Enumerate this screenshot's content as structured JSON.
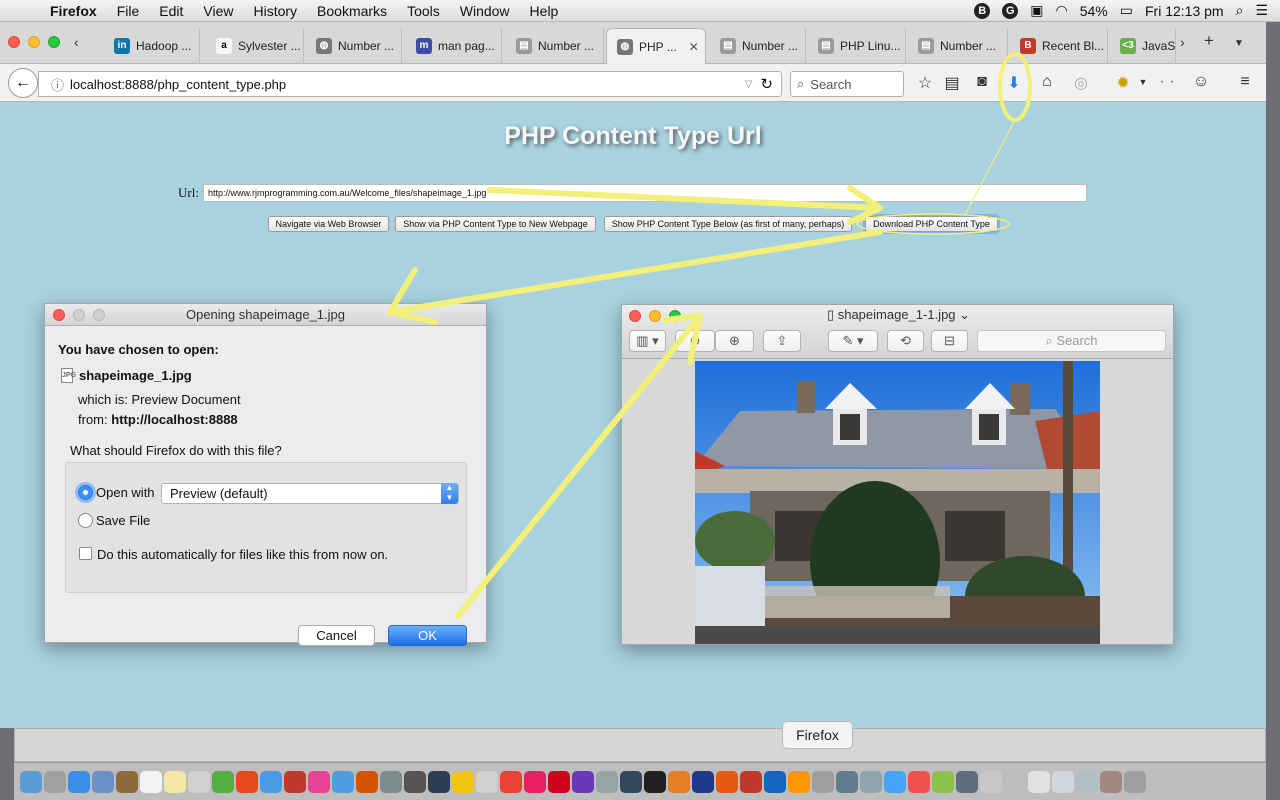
{
  "menubar": {
    "app": "Firefox",
    "items": [
      "File",
      "Edit",
      "View",
      "History",
      "Bookmarks",
      "Tools",
      "Window",
      "Help"
    ],
    "battery": "54%",
    "clock": "Fri 12:13 pm"
  },
  "tabs": [
    {
      "label": "Hadoop ...",
      "favicon": "linkedin-icon",
      "color": "#0e76a8",
      "glyph": "in"
    },
    {
      "label": "Sylvester ...",
      "favicon": "amazon-icon",
      "color": "#f6f6f6",
      "glyph": "a"
    },
    {
      "label": "Number ...",
      "favicon": "globe-icon",
      "color": "#777777",
      "glyph": "◍"
    },
    {
      "label": "man pag...",
      "favicon": "m-icon",
      "color": "#3d4ea5",
      "glyph": "m"
    },
    {
      "label": "Number ...",
      "favicon": "page-icon",
      "color": "#9a9a9a",
      "glyph": "▤"
    },
    {
      "label": "PHP ...",
      "favicon": "globe-icon",
      "color": "#777777",
      "glyph": "◍",
      "active": true
    },
    {
      "label": "Number ...",
      "favicon": "page-icon",
      "color": "#9a9a9a",
      "glyph": "▤"
    },
    {
      "label": "PHP Linu...",
      "favicon": "page-icon",
      "color": "#9a9a9a",
      "glyph": "▤"
    },
    {
      "label": "Number ...",
      "favicon": "page-icon",
      "color": "#9a9a9a",
      "glyph": "▤"
    },
    {
      "label": "Recent Bl...",
      "favicon": "blogger-icon",
      "color": "#c0392b",
      "glyph": "B"
    },
    {
      "label": "JavaSc...",
      "favicon": "js-icon",
      "color": "#6ab04c",
      "glyph": "<3"
    }
  ],
  "navbar": {
    "url": "localhost:8888/php_content_type.php",
    "search_placeholder": "Search"
  },
  "page": {
    "title": "PHP Content Type Url",
    "url_label": "Url:",
    "url_value": "http://www.rjmprogramming.com.au/Welcome_files/shapeimage_1.jpg",
    "buttons": [
      "Navigate via Web Browser",
      "Show via PHP Content Type to New Webpage",
      "Show PHP Content Type Below (as first of many, perhaps)",
      "Download PHP Content Type"
    ]
  },
  "dialog": {
    "title": "Opening shapeimage_1.jpg",
    "chosen": "You have chosen to open:",
    "filename": "shapeimage_1.jpg",
    "which_is": "which is:  Preview Document",
    "from_label": "from:",
    "from_value": "http://localhost:8888",
    "question": "What should Firefox do with this file?",
    "open_with_label": "Open with",
    "open_with_value": "Preview (default)",
    "save_label": "Save File",
    "auto_label": "Do this automatically for files like this from now on.",
    "cancel": "Cancel",
    "ok": "OK"
  },
  "preview": {
    "title": "shapeimage_1-1.jpg",
    "search_placeholder": "Search"
  },
  "dock": {
    "tooltip": "Firefox",
    "icons": [
      "#5b9bd5",
      "#a0a0a0",
      "#3a8ee6",
      "#6b8fc8",
      "#8e6b3a",
      "#f4f4f4",
      "#f2e6a8",
      "#d0d0d0",
      "#52b043",
      "#e64a19",
      "#4a9be6",
      "#c03a2b",
      "#e84393",
      "#4d9de0",
      "#d35400",
      "#7f8c8d",
      "#555555",
      "#2c3e50",
      "#f1c40f",
      "#d0d0d0",
      "#ea4335",
      "#e91e63",
      "#d0021b",
      "#673ab7",
      "#95a5a6",
      "#34495e",
      "#222222",
      "#e67e22",
      "#1e3a8a",
      "#e55b13",
      "#c0392b",
      "#1565c0",
      "#ff9800",
      "#9e9e9e",
      "#607d8b",
      "#90a4ae",
      "#42a5f5",
      "#ef5350",
      "#8bc34a",
      "#5d6d7e",
      "#c8c8c8",
      "#bdbdbd",
      "#e0e0e0",
      "#cfd8dc",
      "#b0bec5",
      "#a1887f",
      "#9e9e9e"
    ]
  }
}
